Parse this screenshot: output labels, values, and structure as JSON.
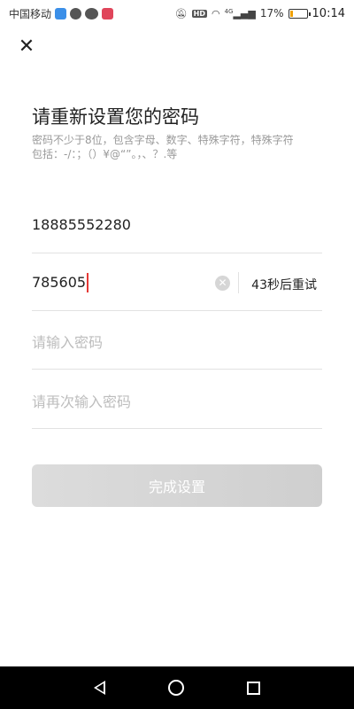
{
  "status_bar": {
    "carrier": "中国移动",
    "network": "4G",
    "hd": "HD",
    "battery_percent": "17%",
    "battery_level": 0.17,
    "time": "10:14"
  },
  "header": {
    "title": "请重新设置您的密码",
    "hint_line1": "密码不少于8位，包含字母、数字、特殊字符，特殊字符",
    "hint_line2": "包括：-/：；（）¥@“”。，、？.等"
  },
  "form": {
    "phone_value": "18885552280",
    "code_value": "785605",
    "resend_label": "43秒后重试",
    "password_placeholder": "请输入密码",
    "password_confirm_placeholder": "请再次输入密码",
    "submit_label": "完成设置"
  },
  "colors": {
    "cursor": "#e53935",
    "button_disabled": "#d5d5d5"
  }
}
